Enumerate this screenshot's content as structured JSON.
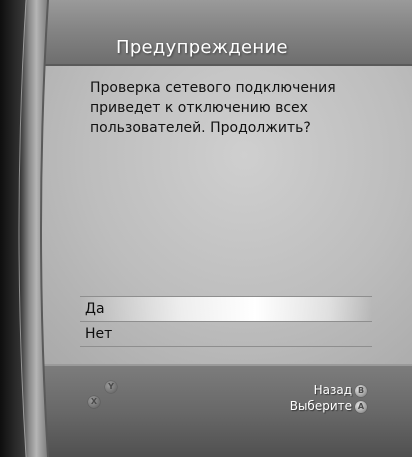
{
  "dialog": {
    "title": "Предупреждение",
    "message": "Проверка сетевого подключения приведет к отключению всех пользователей. Продолжить?"
  },
  "menu": {
    "items": [
      {
        "label": "Да",
        "selected": true
      },
      {
        "label": "Нет",
        "selected": false
      }
    ]
  },
  "footer": {
    "back_label": "Назад",
    "back_button": "B",
    "select_label": "Выберите",
    "select_button": "A",
    "left_buttons": [
      "Y",
      "X"
    ]
  },
  "colors": {
    "header": "#858585",
    "body": "#bdbdbd",
    "footer": "#686868",
    "title_text": "#ffffff",
    "body_text": "#111111"
  }
}
